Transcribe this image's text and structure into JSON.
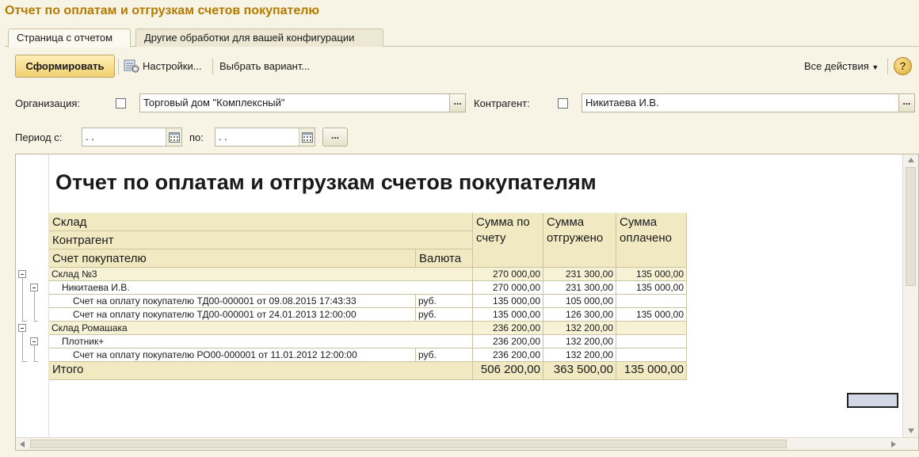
{
  "window": {
    "title": "Отчет по оплатам и отгрузкам счетов покупателю"
  },
  "tabs": [
    {
      "label": "Страница с отчетом",
      "active": true
    },
    {
      "label": "Другие обработки для вашей конфигурации",
      "active": false
    }
  ],
  "toolbar": {
    "generate_label": "Сформировать",
    "settings_label": "Настройки...",
    "choose_variant_label": "Выбрать вариант...",
    "all_actions_label": "Все действия",
    "help_label": "?"
  },
  "filters": {
    "organization_label": "Организация:",
    "organization_value": "Торговый дом \"Комплексный\"",
    "counterparty_label": "Контрагент:",
    "counterparty_value": "Никитаева И.В.",
    "period_from_label": "Период с:",
    "period_from_value": " .  .",
    "period_to_label": "по:",
    "period_to_value": " .  .",
    "dots": "..."
  },
  "report": {
    "title": "Отчет по оплатам и отгрузкам счетов покупателям",
    "headers": {
      "warehouse": "Склад",
      "counterparty": "Контрагент",
      "invoice": "Счет покупателю",
      "currency": "Валюта",
      "sum_invoice": "Сумма по счету",
      "sum_shipped": "Сумма отгружено",
      "sum_paid": "Сумма оплачено"
    },
    "rows": [
      {
        "level": 0,
        "text": "Склад №3",
        "currency": "",
        "sum": "270 000,00",
        "shipped": "231 300,00",
        "paid": "135 000,00"
      },
      {
        "level": 1,
        "text": "Никитаева И.В.",
        "currency": "",
        "sum": "270 000,00",
        "shipped": "231 300,00",
        "paid": "135 000,00"
      },
      {
        "level": 2,
        "text": "Счет на оплату покупателю ТД00-000001 от 09.08.2015 17:43:33",
        "currency": "руб.",
        "sum": "135 000,00",
        "shipped": "105 000,00",
        "paid": ""
      },
      {
        "level": 2,
        "text": "Счет на оплату покупателю ТД00-000001 от 24.01.2013 12:00:00",
        "currency": "руб.",
        "sum": "135 000,00",
        "shipped": "126 300,00",
        "paid": "135 000,00"
      },
      {
        "level": 0,
        "text": "Склад Ромашака",
        "currency": "",
        "sum": "236 200,00",
        "shipped": "132 200,00",
        "paid": ""
      },
      {
        "level": 1,
        "text": "Плотник+",
        "currency": "",
        "sum": "236 200,00",
        "shipped": "132 200,00",
        "paid": ""
      },
      {
        "level": 2,
        "text": "Счет на оплату покупателю РО00-000001 от 11.01.2012 12:00:00",
        "currency": "руб.",
        "sum": "236 200,00",
        "shipped": "132 200,00",
        "paid": ""
      }
    ],
    "total": {
      "label": "Итого",
      "sum": "506 200,00",
      "shipped": "363 500,00",
      "paid": "135 000,00"
    }
  }
}
